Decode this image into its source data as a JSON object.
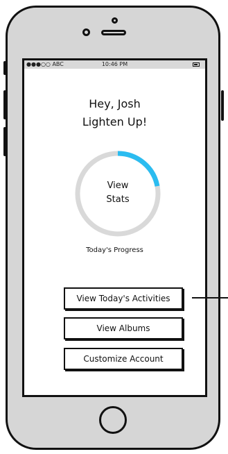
{
  "status_bar": {
    "carrier": "●●●○○ ABC",
    "time": "10:46 PM"
  },
  "greeting": {
    "line1": "Hey, Josh",
    "line2": "Lighten Up!"
  },
  "progress": {
    "ring_line1": "View",
    "ring_line2": "Stats",
    "caption": "Today's Progress",
    "fraction": 0.22,
    "track_color": "#d9d9d9",
    "fill_color": "#2bbcf0"
  },
  "actions": {
    "view_activities": "View Today's Activities",
    "view_albums": "View Albums",
    "customize_account": "Customize Account"
  },
  "icons": {
    "camera": "camera-dot-icon",
    "speaker": "speaker-slot-icon",
    "battery": "battery-icon",
    "home": "home-button-icon"
  }
}
